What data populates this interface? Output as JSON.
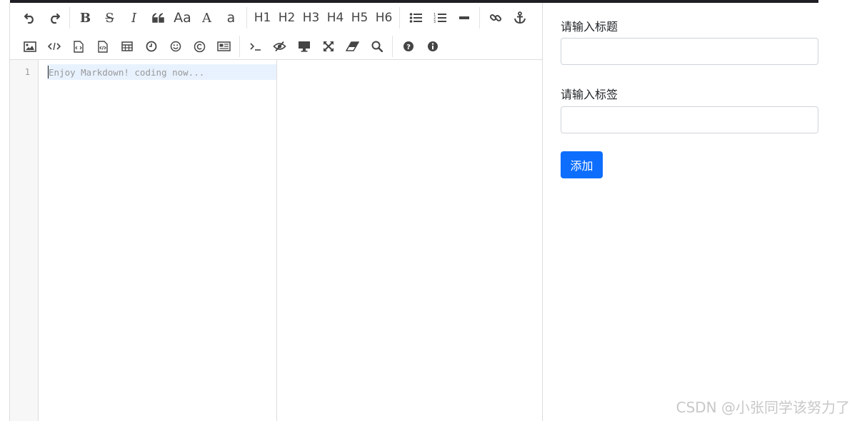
{
  "toolbar": {
    "row1": {
      "undo": "undo-icon",
      "redo": "redo-icon",
      "bold": "B",
      "strikethrough": "S",
      "italic": "I",
      "quote": "quote-icon",
      "uppercase_words": "Aa",
      "uppercase": "A",
      "lowercase": "a",
      "h1": "H1",
      "h2": "H2",
      "h3": "H3",
      "h4": "H4",
      "h5": "H5",
      "h6": "H6",
      "unordered_list": "list-ul-icon",
      "ordered_list": "list-ol-icon",
      "horizontal_rule": "minus-icon",
      "link": "link-icon",
      "anchor": "anchor-icon"
    },
    "row2": {
      "image": "image-icon",
      "code": "code-icon",
      "preformatted": "file-code-icon",
      "code_block": "file-code-icon",
      "table": "table-icon",
      "datetime": "clock-icon",
      "emoji": "smile-icon",
      "html_entities": "copyright-icon",
      "pagebreak": "newspaper-icon",
      "goto_line": "terminal-icon",
      "watch": "eye-slash-icon",
      "preview": "desktop-icon",
      "fullscreen": "expand-icon",
      "clear": "eraser-icon",
      "search": "search-icon",
      "help": "question-circle-icon",
      "info": "info-circle-icon"
    }
  },
  "editor": {
    "line_number": "1",
    "placeholder": "Enjoy Markdown! coding now..."
  },
  "form": {
    "title_label": "请输入标题",
    "title_value": "",
    "tags_label": "请输入标签",
    "tags_value": "",
    "add_button": "添加"
  },
  "watermark": "CSDN @小张同学该努力了",
  "colors": {
    "primary_button": "#0d6efd",
    "active_line": "#e8f2ff",
    "top_bar": "#1e1e24"
  }
}
